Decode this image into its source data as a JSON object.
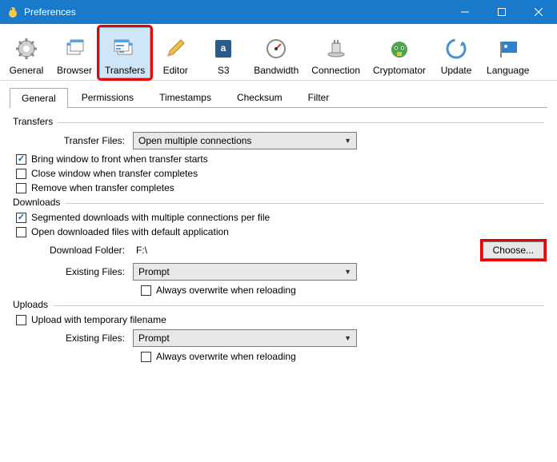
{
  "window": {
    "title": "Preferences"
  },
  "toolbar": [
    {
      "label": "General"
    },
    {
      "label": "Browser"
    },
    {
      "label": "Transfers"
    },
    {
      "label": "Editor"
    },
    {
      "label": "S3"
    },
    {
      "label": "Bandwidth"
    },
    {
      "label": "Connection"
    },
    {
      "label": "Cryptomator"
    },
    {
      "label": "Update"
    },
    {
      "label": "Language"
    }
  ],
  "tabs": [
    {
      "label": "General"
    },
    {
      "label": "Permissions"
    },
    {
      "label": "Timestamps"
    },
    {
      "label": "Checksum"
    },
    {
      "label": "Filter"
    }
  ],
  "transfers": {
    "legend": "Transfers",
    "transfer_files_label": "Transfer Files:",
    "transfer_files_value": "Open multiple connections",
    "bring_front": "Bring window to front when transfer starts",
    "close_when_complete": "Close window when transfer completes",
    "remove_when_complete": "Remove when transfer completes"
  },
  "downloads": {
    "legend": "Downloads",
    "segmented": "Segmented downloads with multiple connections per file",
    "open_default": "Open downloaded files with default application",
    "folder_label": "Download Folder:",
    "folder_value": "F:\\",
    "choose": "Choose...",
    "existing_label": "Existing Files:",
    "existing_value": "Prompt",
    "always_overwrite": "Always overwrite when reloading"
  },
  "uploads": {
    "legend": "Uploads",
    "temp": "Upload with temporary filename",
    "existing_label": "Existing Files:",
    "existing_value": "Prompt",
    "always_overwrite": "Always overwrite when reloading"
  }
}
